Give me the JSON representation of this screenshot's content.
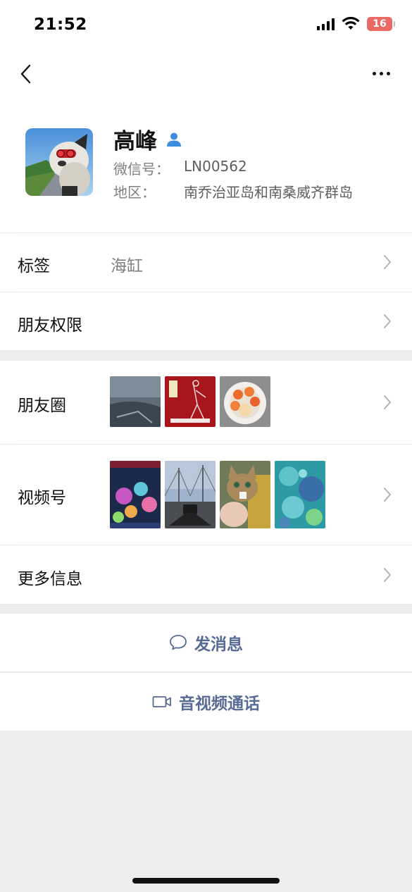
{
  "status_bar": {
    "time": "21:52",
    "battery": "16"
  },
  "nav": {
    "back_icon": "chevron-left-icon",
    "more_icon": "more-dots-icon"
  },
  "profile": {
    "name": "高峰",
    "wechat_id_label": "微信号：",
    "wechat_id": "LN00562",
    "region_label": "地区：",
    "region": "南乔治亚岛和南桑威齐群岛"
  },
  "rows": {
    "tags": {
      "label": "标签",
      "value": "海缸"
    },
    "permissions": {
      "label": "朋友权限"
    },
    "moments": {
      "label": "朋友圈"
    },
    "channels": {
      "label": "视频号"
    },
    "more_info": {
      "label": "更多信息"
    }
  },
  "actions": {
    "message": "发消息",
    "call": "音视频通话"
  },
  "colors": {
    "link": "#576b95",
    "background": "#ededed",
    "verified_icon": "#3d8ddf"
  }
}
